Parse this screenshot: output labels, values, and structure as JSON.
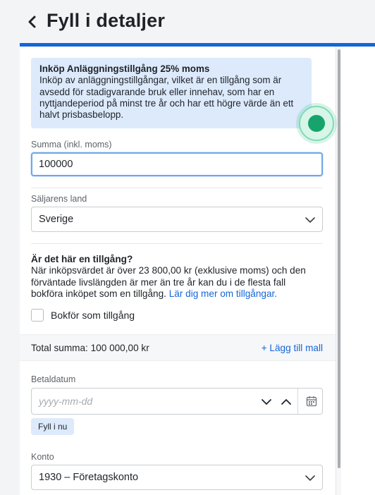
{
  "header": {
    "title": "Fyll i detaljer",
    "back_icon": "chevron-left-icon"
  },
  "info_box": {
    "title": "Inköp Anläggningstillgång 25% moms",
    "body": "Inköp av anläggningstillgångar, vilket är en tillgång som är avsedd för stadigvarande bruk eller innehav, som har en nyttjandeperiod på minst tre år och har ett högre värde än ett halvt prisbasbelopp."
  },
  "amount": {
    "label": "Summa (inkl. moms)",
    "value": "100000"
  },
  "seller_country": {
    "label": "Säljarens land",
    "value": "Sverige"
  },
  "asset_question": {
    "title": "Är det här en tillgång?",
    "body": "När inköpsvärdet är över 23 800,00 kr (exklusive moms) och den förväntade livslängden är mer än tre år kan du i de flesta fall bokföra inköpet som en tillgång. ",
    "link": "Lär dig mer om tillgångar.",
    "checkbox_label": "Bokför som tillgång",
    "checkbox_checked": false
  },
  "total": {
    "text": "Total summa: 100 000,00 kr",
    "add_template": "+ Lägg till mall"
  },
  "payment_date": {
    "label": "Betaldatum",
    "placeholder": "yyyy-mm-dd",
    "today_button": "Fyll i nu"
  },
  "account": {
    "label": "Konto",
    "value": "1930 – Företagskonto"
  },
  "colors": {
    "accent": "#1565d8",
    "info_background": "#dceafc",
    "touch_indicator": "#17a46c"
  }
}
